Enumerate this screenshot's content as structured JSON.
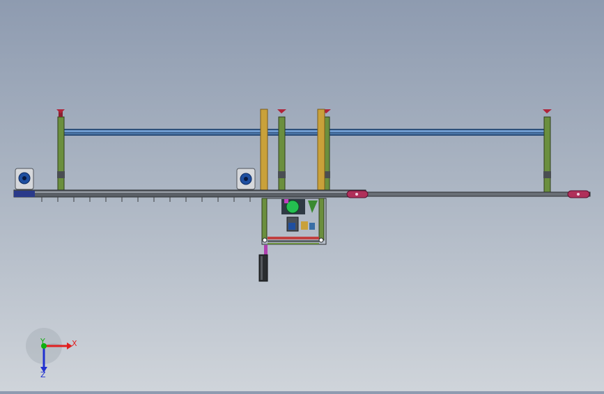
{
  "axis_triad": {
    "x_label": "X",
    "y_label": "Y",
    "z_label": "Z",
    "x_color": "#e02020",
    "y_color": "#10b010",
    "z_color": "#2030d0"
  },
  "colors": {
    "beam_blue": "#3a6fa6",
    "rail_gray": "#5a5f66",
    "column_green": "#5f8f3a",
    "column_tan": "#c9a13a",
    "foot_red": "#b0243a",
    "end_cap_magenta": "#b0305a",
    "motor_gray": "#d6d8dc",
    "motor_blue": "#1f4fa0"
  }
}
